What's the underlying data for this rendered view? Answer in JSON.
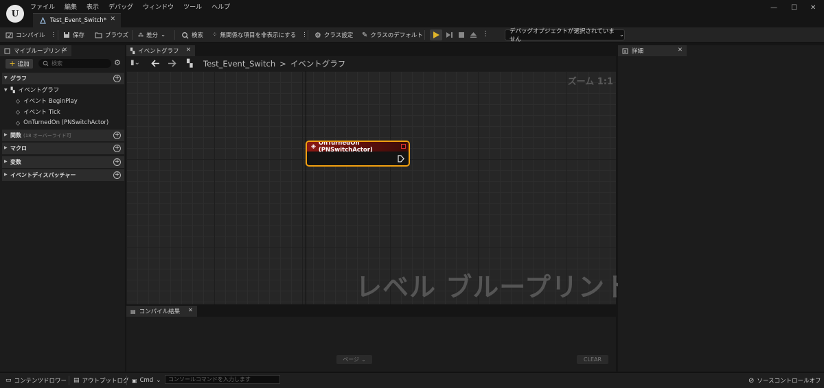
{
  "menu": [
    "ファイル",
    "編集",
    "表示",
    "デバッグ",
    "ウィンドウ",
    "ツール",
    "ヘルプ"
  ],
  "document_tab": "Test_Event_Switch*",
  "toolbar": {
    "compile": "コンパイル",
    "save": "保存",
    "browse": "ブラウズ",
    "diff": "差分",
    "search": "検索",
    "hide_unrelated": "無関係な項目を非表示にする",
    "class_settings": "クラス設定",
    "class_defaults": "クラスのデフォルト",
    "debug_object": "デバッグオブジェクトが選択されていません"
  },
  "my_blueprint": {
    "tab": "マイブループリント",
    "add": "追加",
    "search_placeholder": "検索",
    "sections": {
      "graphs": "グラフ",
      "functions": "関数",
      "functions_note": "(18 オーバーライド可",
      "macros": "マクロ",
      "variables": "変数",
      "dispatchers": "イベントディスパッチャー"
    },
    "tree": {
      "event_graph": "イベントグラフ",
      "items": [
        "イベント BeginPlay",
        "イベント Tick",
        "OnTurnedOn (PNSwitchActor)"
      ]
    }
  },
  "graph": {
    "tab": "イベントグラフ",
    "breadcrumb_root": "Test_Event_Switch",
    "breadcrumb_sep": ">",
    "breadcrumb_current": "イベントグラフ",
    "zoom": "ズーム 1:1",
    "watermark": "レベル ブループリント",
    "node_title": "OnTurnedOn (PNSwitchActor)"
  },
  "compile_results": {
    "tab": "コンパイル結果",
    "page": "ページ",
    "clear": "CLEAR"
  },
  "details": {
    "tab": "詳細"
  },
  "statusbar": {
    "content_drawer": "コンテンツドロワー",
    "output_log": "アウトプットログ",
    "cmd": "Cmd",
    "cmd_placeholder": "コンソールコマンドを入力します",
    "source_control": "ソースコントロールオフ"
  },
  "colors": {
    "accent_play": "#e0b52a",
    "node_border": "#f2a010",
    "node_header": "#8b1a14"
  }
}
